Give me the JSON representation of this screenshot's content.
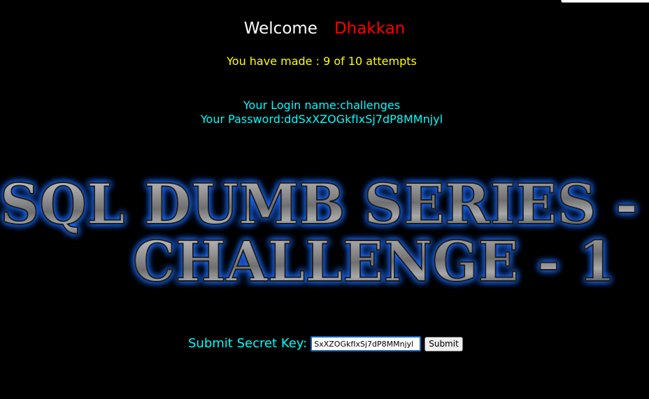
{
  "header": {
    "welcome_label": "Welcome",
    "username": "Dhakkan"
  },
  "attempts_text": "You have made : 9 of 10 attempts",
  "credentials": {
    "login_line": "Your Login name:challenges",
    "password_line": "Your Password:ddSxXZOGkfIxSj7dP8MMnjyl"
  },
  "banner": {
    "line1": "SQL DUMB SERIES -",
    "line2": "CHALLENGE - 1"
  },
  "form": {
    "label": "Submit Secret Key:",
    "key_value": "SxXZOGkfIxSj7dP8MMnjyl",
    "submit_label": "Submit"
  },
  "colors": {
    "background": "#000000",
    "welcome": "#ffffff",
    "username": "#ff0000",
    "attempts": "#ffff00",
    "credentials": "#00ffff",
    "banner_glow": "#1e6bff",
    "banner_metal": "#9a9a9a"
  }
}
